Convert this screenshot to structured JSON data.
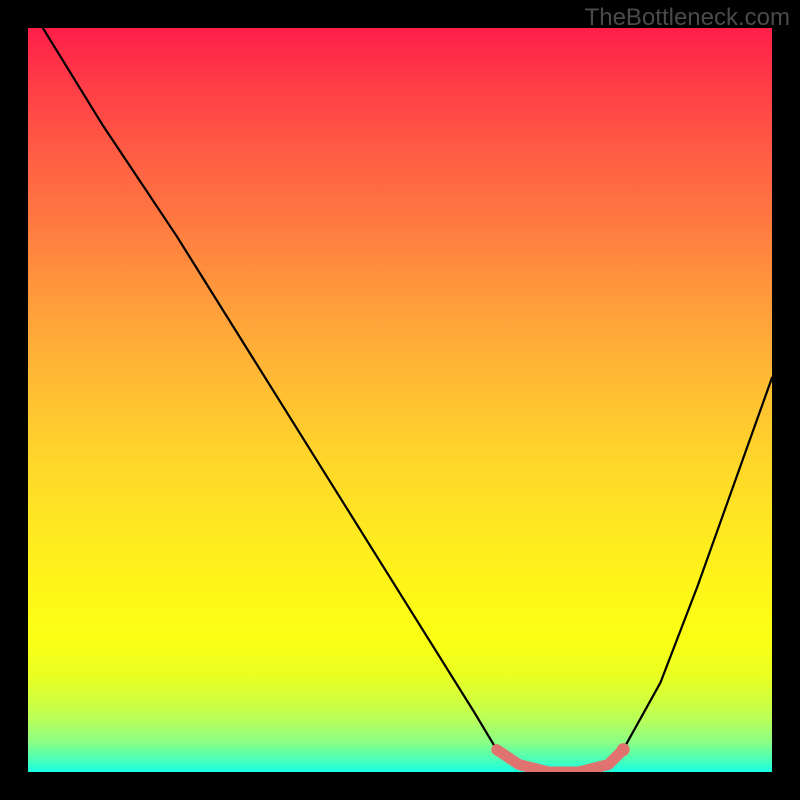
{
  "watermark": "TheBottleneck.com",
  "chart_data": {
    "type": "line",
    "title": "",
    "xlabel": "",
    "ylabel": "",
    "xlim": [
      0,
      100
    ],
    "ylim": [
      0,
      100
    ],
    "grid": false,
    "legend": false,
    "series": [
      {
        "name": "curve",
        "color": "#000000",
        "x": [
          2,
          10,
          20,
          30,
          40,
          50,
          55,
          60,
          63,
          66,
          70,
          74,
          78,
          80,
          85,
          90,
          95,
          100
        ],
        "y": [
          100,
          87,
          72,
          56,
          40,
          24,
          16,
          8,
          3,
          1,
          0,
          0,
          1,
          3,
          12,
          25,
          39,
          53
        ]
      },
      {
        "name": "highlight",
        "color": "#e0736f",
        "x": [
          63,
          66,
          70,
          74,
          78,
          80
        ],
        "y": [
          3,
          1,
          0,
          0,
          1,
          3
        ]
      }
    ],
    "gradient_stops": [
      {
        "pos": 0,
        "color": "#ff1e49"
      },
      {
        "pos": 0.5,
        "color": "#ffd12c"
      },
      {
        "pos": 0.82,
        "color": "#fbff14"
      },
      {
        "pos": 1.0,
        "color": "#18ffe3"
      }
    ]
  }
}
